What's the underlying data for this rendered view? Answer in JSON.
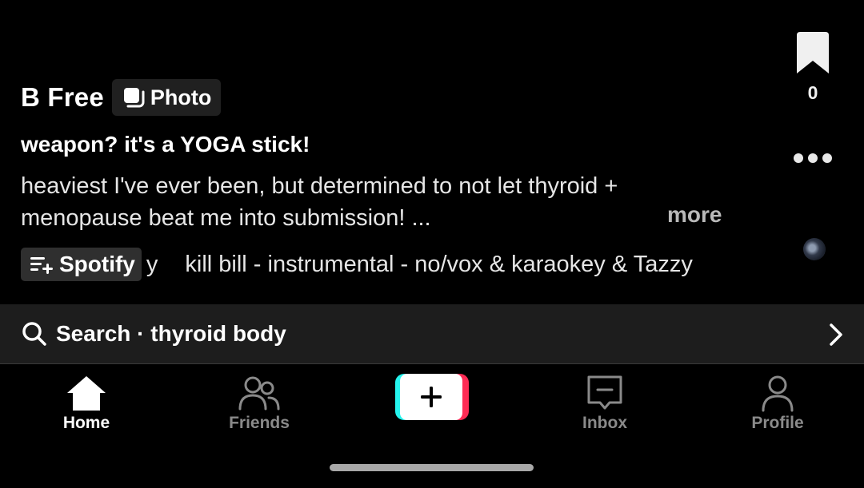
{
  "post": {
    "author": "B Free",
    "type_badge": "Photo",
    "title": "weapon? it's a YOGA stick!",
    "description_line1": "heaviest I've ever been, but determined to not let thyroid +",
    "description_line2": "menopause beat me into submission! ...",
    "more_label": "more"
  },
  "music": {
    "spotify_label": "Spotify",
    "prefix": "y",
    "track": "kill bill - instrumental - no/vox & karaokey & Tazzy"
  },
  "rail": {
    "bookmark_count": "0",
    "bookmark_icon": "bookmark-icon",
    "more_icon": "more-dots-icon",
    "disc_icon": "music-disc-icon"
  },
  "search": {
    "prefix": "Search",
    "separator": "·",
    "query": "thyroid body",
    "full_text": "Search · thyroid body"
  },
  "nav": {
    "home": "Home",
    "friends": "Friends",
    "inbox": "Inbox",
    "profile": "Profile",
    "create_icon": "plus-icon"
  },
  "colors": {
    "background": "#000000",
    "search_bar": "#1d1d1d",
    "chip": "#2f2f2f",
    "create_cyan": "#25f4ee",
    "create_red": "#fe2c55",
    "inactive_nav": "#8a8a8a"
  }
}
